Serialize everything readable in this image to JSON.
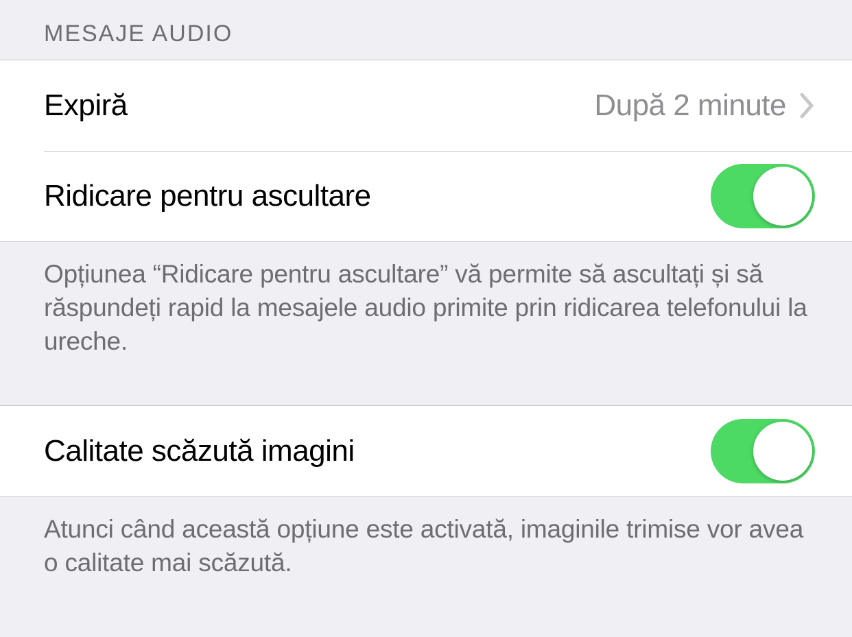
{
  "section1": {
    "header": "MESAJE AUDIO",
    "rows": {
      "expire": {
        "label": "Expiră",
        "value": "După 2 minute"
      },
      "raise_to_listen": {
        "label": "Ridicare pentru ascultare",
        "toggle_on": true
      }
    },
    "footer": "Opțiunea “Ridicare pentru ascultare” vă permite să ascultați și să răspundeți rapid la mesajele audio primite prin ridicarea telefonului la ureche."
  },
  "section2": {
    "rows": {
      "low_quality_images": {
        "label": "Calitate scăzută imagini",
        "toggle_on": true
      }
    },
    "footer": "Atunci când această opțiune este activată, imaginile trimise vor avea o calitate mai scăzută."
  }
}
